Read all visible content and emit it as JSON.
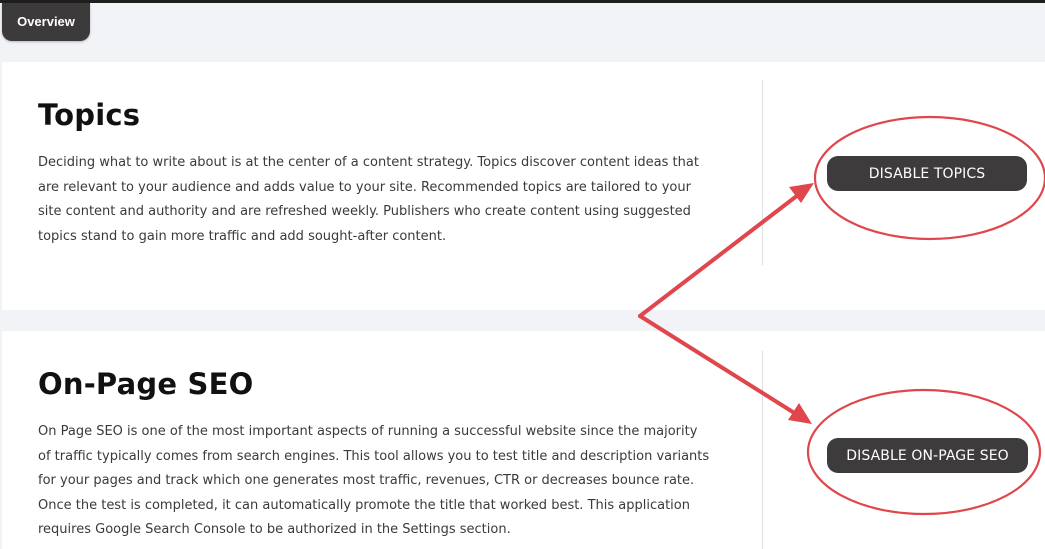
{
  "tabs": {
    "overview": "Overview"
  },
  "sections": {
    "topics": {
      "title": "Topics",
      "description": "Deciding what to write about is at the center of a content strategy. Topics discover content ideas that are relevant to your audience and adds value to your site. Recommended topics are tailored to your site content and authority and are refreshed weekly. Publishers who create content using suggested topics stand to gain more traffic and add sought-after content.",
      "button_label": "DISABLE TOPICS"
    },
    "seo": {
      "title": "On-Page SEO",
      "description": "On Page SEO is one of the most important aspects of running a successful website since the majority of traffic typically comes from search engines. This tool allows you to test title and description variants for your pages and track which one generates most traffic, revenues, CTR or decreases bounce rate. Once the test is completed, it can automatically promote the title that worked best. This application requires Google Search Console to be authorized in the Settings section.",
      "button_label": "DISABLE ON-PAGE SEO"
    }
  },
  "colors": {
    "annotation": "#e0474c",
    "button": "#3d3b3b"
  }
}
